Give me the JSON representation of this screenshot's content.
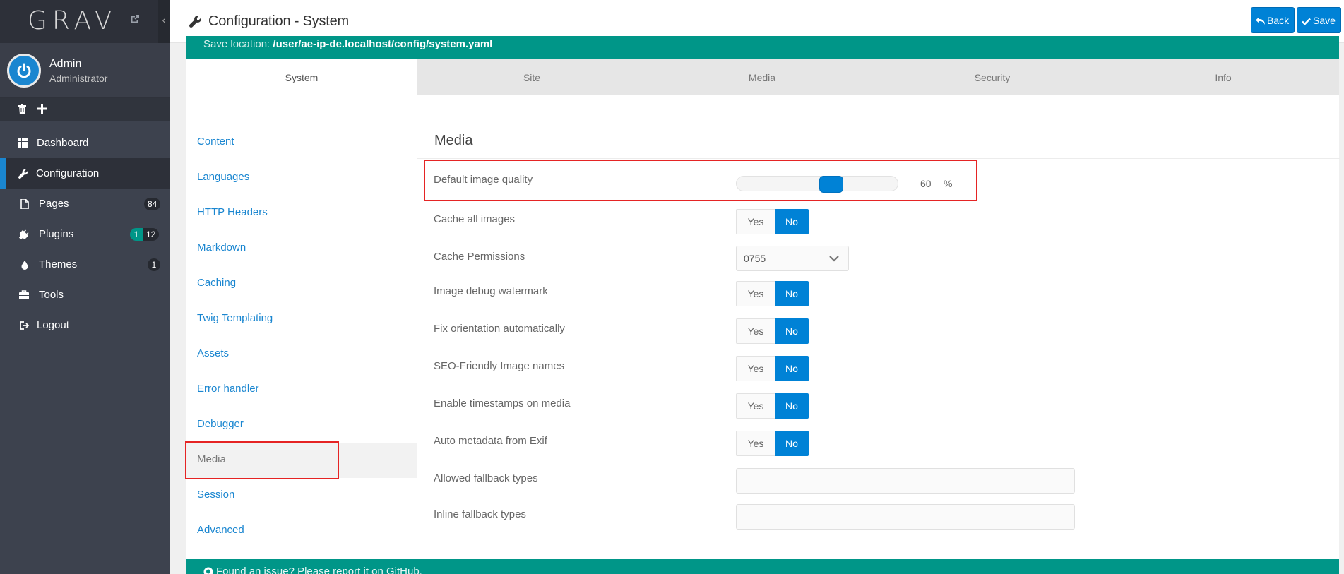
{
  "app": {
    "brand": "GRAV",
    "page_title": "Configuration - System"
  },
  "user": {
    "name": "Admin",
    "role": "Administrator"
  },
  "sidebar": {
    "items": [
      {
        "label": "Dashboard",
        "icon": "grid-icon"
      },
      {
        "label": "Configuration",
        "icon": "wrench-icon",
        "active": true
      },
      {
        "label": "Pages",
        "icon": "file-icon",
        "badge": "84"
      },
      {
        "label": "Plugins",
        "icon": "plug-icon",
        "badge_green": "1",
        "badge": "12"
      },
      {
        "label": "Themes",
        "icon": "droplet-icon",
        "badge": "1"
      },
      {
        "label": "Tools",
        "icon": "briefcase-icon"
      },
      {
        "label": "Logout",
        "icon": "sign-out-icon"
      }
    ]
  },
  "toolbar": {
    "back_label": "Back",
    "save_label": "Save"
  },
  "notice": {
    "prefix": "Save location: ",
    "path": "/user/ae-ip-de.localhost/config/system.yaml"
  },
  "tabs": [
    "System",
    "Site",
    "Media",
    "Security",
    "Info"
  ],
  "section_menu": [
    "Content",
    "Languages",
    "HTTP Headers",
    "Markdown",
    "Caching",
    "Twig Templating",
    "Assets",
    "Error handler",
    "Debugger",
    "Media",
    "Session",
    "Advanced"
  ],
  "section_selected": "Media",
  "form": {
    "heading": "Media",
    "default_image_quality": {
      "label": "Default image quality",
      "value": "60",
      "unit": "%",
      "fraction": 0.6
    },
    "cache_all_images": {
      "label": "Cache all images"
    },
    "cache_permissions": {
      "label": "Cache Permissions",
      "value": "0755"
    },
    "image_debug_watermark": {
      "label": "Image debug watermark"
    },
    "fix_orientation": {
      "label": "Fix orientation automatically"
    },
    "seo_friendly": {
      "label": "SEO-Friendly Image names"
    },
    "enable_timestamps": {
      "label": "Enable timestamps on media"
    },
    "auto_metadata": {
      "label": "Auto metadata from Exif"
    },
    "allowed_fallback": {
      "label": "Allowed fallback types",
      "value": ""
    },
    "inline_fallback": {
      "label": "Inline fallback types",
      "value": ""
    },
    "yes_label": "Yes",
    "no_label": "No"
  },
  "footer": {
    "text": "Found an issue? Please report it on GitHub."
  },
  "colors": {
    "accent": "#0082d6",
    "teal": "#009688",
    "sidebar": "#3d424e"
  }
}
